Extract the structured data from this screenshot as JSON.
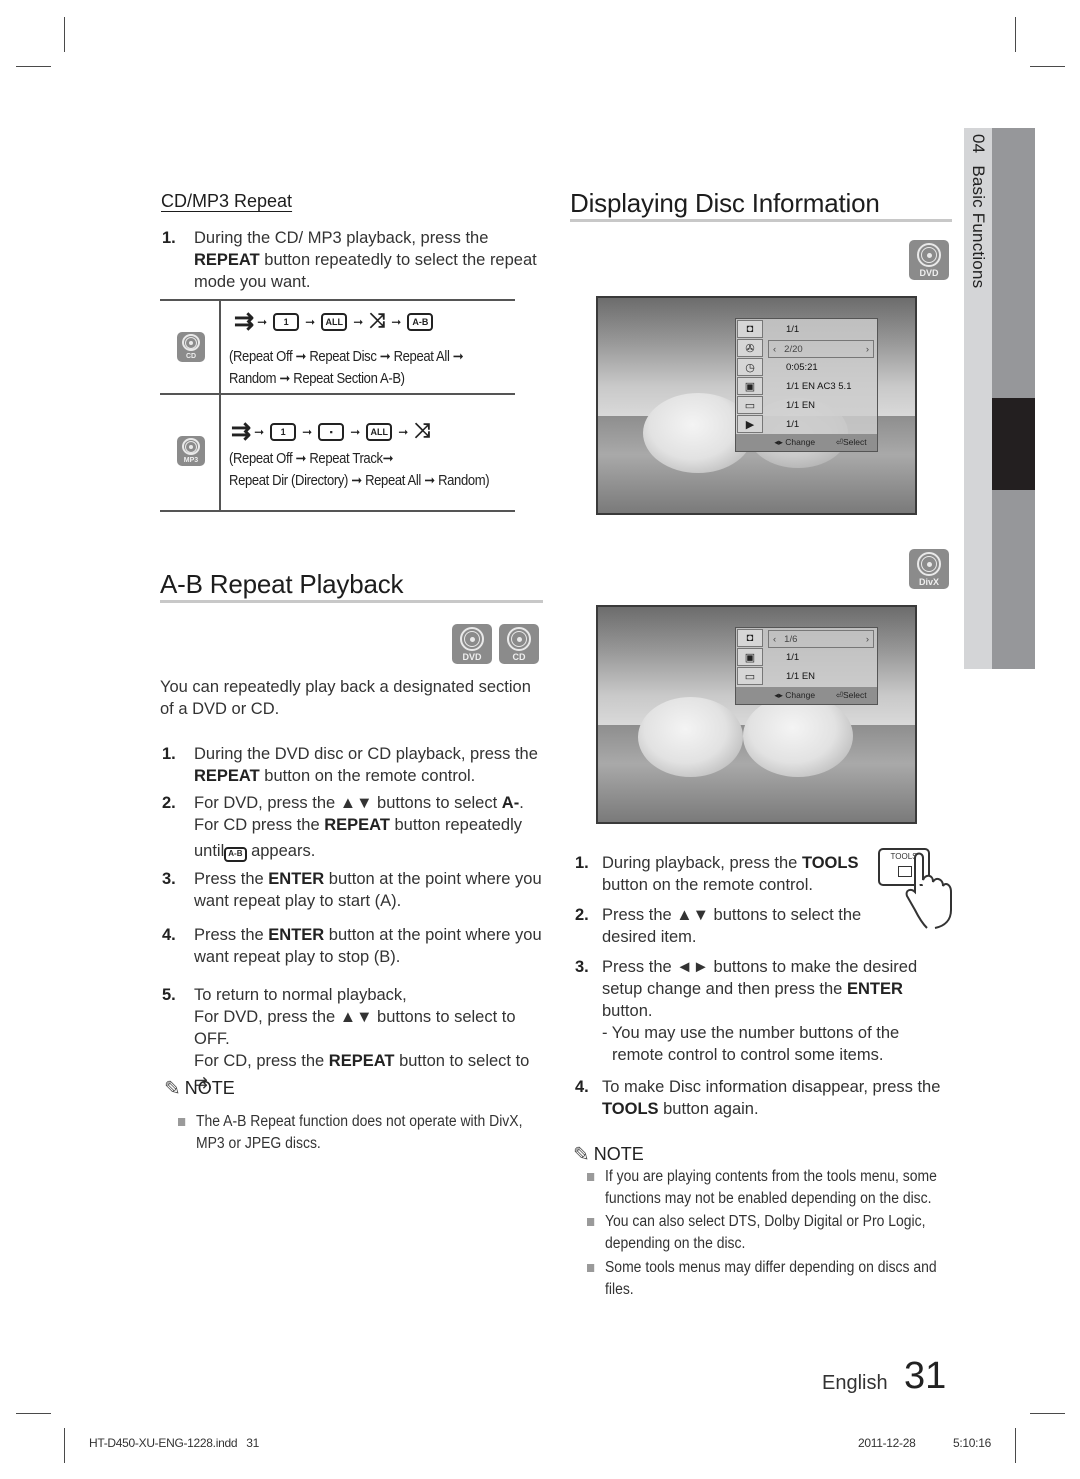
{
  "section_tab": {
    "chapter_number": "04",
    "chapter_title": "Basic Functions"
  },
  "cd_mp3_repeat": {
    "title": "CD/MP3 Repeat",
    "step1": {
      "num": "1.",
      "text_a": "During the CD/ MP3 playback, press the",
      "bold": "REPEAT",
      "text_b": " button repeatedly to select the repeat mode you want."
    },
    "modes": [
      {
        "disc": "CD",
        "sequence": [
          "repeat-off-icon",
          "repeat-one-icon",
          "repeat-all-icon",
          "random-icon",
          "repeat-ab-icon"
        ],
        "sequence_labels": [
          "⇉",
          "1",
          "ALL",
          "⤨",
          "A-B"
        ],
        "desc_line1": "(Repeat Off ➞ Repeat Disc ➞ Repeat All ➞",
        "desc_line2": "Random ➞ Repeat Section A-B)"
      },
      {
        "disc": "MP3",
        "sequence": [
          "repeat-off-icon",
          "repeat-one-icon",
          "repeat-dir-icon",
          "repeat-all-icon",
          "random-icon"
        ],
        "sequence_labels": [
          "⇉",
          "1",
          "▪",
          "ALL",
          "⤨"
        ],
        "desc_line1": "(Repeat Off  ➞ Repeat Track➞",
        "desc_line2": "Repeat Dir (Directory) ➞ Repeat All ➞ Random)"
      }
    ]
  },
  "ab_repeat": {
    "title": "A-B Repeat Playback",
    "discs": [
      "DVD",
      "CD"
    ],
    "intro": "You can repeatedly play back a designated section of a DVD or CD.",
    "steps": [
      {
        "num": "1.",
        "a": "During the DVD disc or CD playback, press the ",
        "b": "REPEAT",
        "c": " button on the remote control."
      },
      {
        "num": "2.",
        "a": "For DVD, press the ▲▼ buttons to select ",
        "b": "A-",
        "c": ".",
        "line2_a": "For CD press the ",
        "line2_b": "REPEAT",
        "line2_c": " button repeatedly",
        "line3_a": "until ",
        "line3_icon": "A-B",
        "line3_c": " appears."
      },
      {
        "num": "3.",
        "a": "Press the ",
        "b": "ENTER",
        "c": " button at the point where you want repeat play to start (A)."
      },
      {
        "num": "4.",
        "a": "Press the ",
        "b": "ENTER",
        "c": " button at the point where you want repeat play to stop (B)."
      },
      {
        "num": "5.",
        "a": "To return to normal playback,",
        "line2": "For DVD, press the ▲▼ buttons to select to OFF.",
        "line3_a": "For CD, press the ",
        "line3_b": "REPEAT",
        "line3_c": " button to select to ⇉."
      }
    ],
    "note_label": "NOTE",
    "notes": [
      "The A-B Repeat function does not operate with DivX, MP3 or JPEG discs."
    ]
  },
  "disc_info": {
    "title": "Displaying Disc Information",
    "dvd_disc": "DVD",
    "divx_disc": "DivX",
    "dvd_osd": {
      "rows": [
        "1/1",
        "2/20",
        "0:05:21",
        "1/1 EN AC3 5.1",
        "1/1 EN",
        "1/1"
      ],
      "selected_index": 1,
      "icons": [
        "title-icon",
        "chapter-icon",
        "time-icon",
        "audio-icon",
        "subtitle-icon",
        "angle-icon"
      ],
      "footer_change": "◂▸ Change",
      "footer_select": "Select"
    },
    "divx_osd": {
      "rows": [
        "1/6",
        "1/1",
        "1/1 EN"
      ],
      "selected_index": 0,
      "icons": [
        "title-icon",
        "audio-icon",
        "subtitle-icon"
      ],
      "footer_change": "◂▸ Change",
      "footer_select": "Select"
    },
    "tools_button_label": "TOOLS",
    "steps": [
      {
        "num": "1.",
        "a": "During playback, press the ",
        "b": "TOOLS",
        "c": " button on the remote control."
      },
      {
        "num": "2.",
        "a": "Press the ▲▼ buttons to select the desired item."
      },
      {
        "num": "3.",
        "a": "Press the ◄► buttons to make the desired setup change and then press the ",
        "b": "ENTER",
        "c": " button.",
        "sub": "- You may use the number buttons of the remote control to control some items."
      },
      {
        "num": "4.",
        "a": "To make Disc information disappear, press the ",
        "b": "TOOLS",
        "c": " button again."
      }
    ],
    "note_label": "NOTE",
    "notes": [
      "If you are playing contents from the tools menu, some functions may not be enabled depending on the disc.",
      "You can also select DTS, Dolby Digital or Pro Logic, depending on the disc.",
      "Some tools menus may differ depending on discs and files."
    ]
  },
  "footer": {
    "language": "English",
    "page_number": "31",
    "slug_file": "HT-D450-XU-ENG-1228.indd   31",
    "slug_date": "2011-12-28",
    "slug_time": "5:10:16"
  }
}
